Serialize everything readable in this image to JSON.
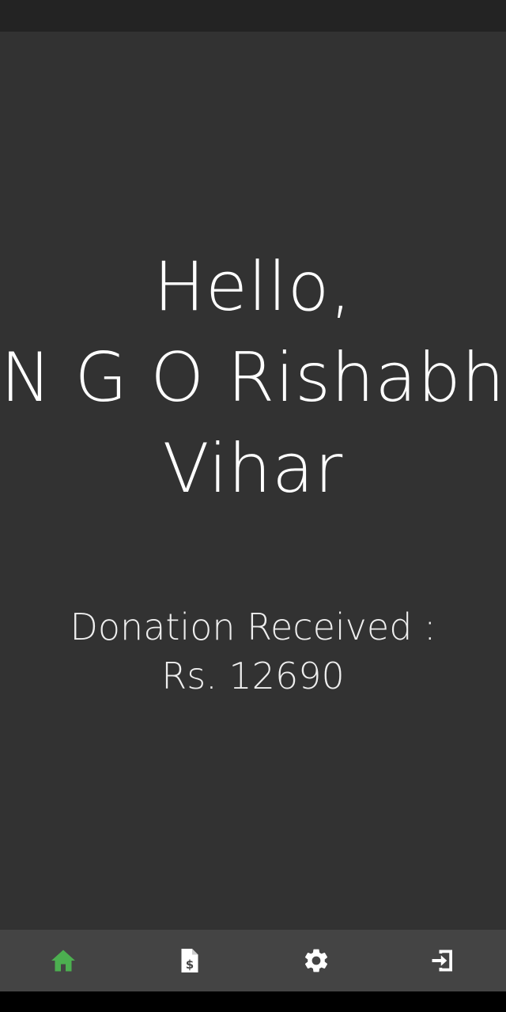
{
  "greeting": {
    "hello": "Hello,",
    "name_line1": "N G O Rishabh",
    "name_line2": "Vihar"
  },
  "donation": {
    "label": "Donation Received :",
    "amount": "Rs. 12690"
  },
  "bottom_nav": {
    "items": [
      {
        "icon": "home-icon",
        "active": true
      },
      {
        "icon": "invoice-dollar-icon",
        "active": false
      },
      {
        "icon": "gear-icon",
        "active": false
      },
      {
        "icon": "logout-icon",
        "active": false
      }
    ]
  },
  "colors": {
    "background": "#323232",
    "status_bar": "#232323",
    "nav_bar": "#444444",
    "active_icon": "#4caf50",
    "icon": "#ffffff",
    "text": "#ffffff"
  }
}
